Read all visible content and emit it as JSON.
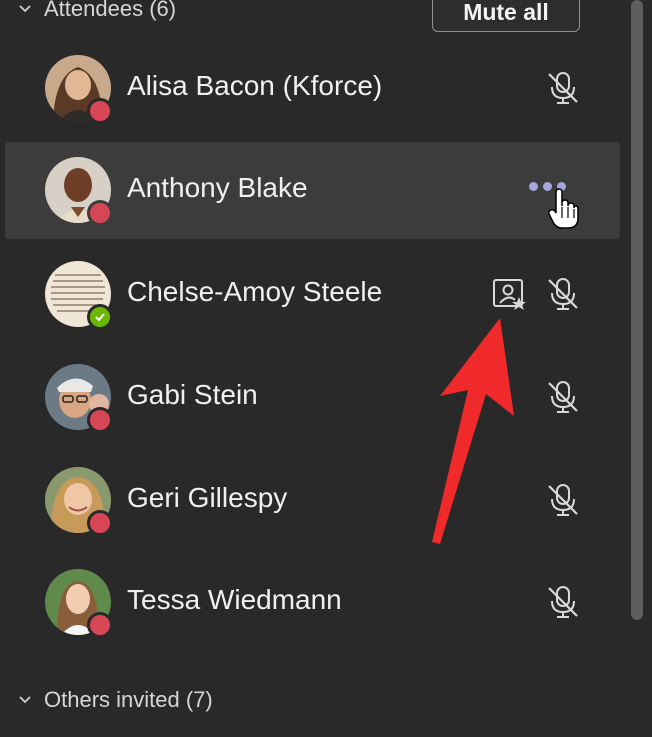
{
  "attendees_section": {
    "label": "Attendees (6)",
    "mute_all_label": "Mute all"
  },
  "others_section": {
    "label": "Others invited (7)"
  },
  "attendees": [
    {
      "name": "Alisa Bacon (Kforce)",
      "status": "busy",
      "mic": "muted"
    },
    {
      "name": "Anthony Blake",
      "status": "busy",
      "hovered": true,
      "action": "more-options"
    },
    {
      "name": "Chelse-Amoy Steele",
      "status": "available",
      "mic": "muted",
      "spotlight": true
    },
    {
      "name": "Gabi Stein",
      "status": "busy",
      "mic": "muted"
    },
    {
      "name": "Geri Gillespy",
      "status": "busy",
      "mic": "muted"
    },
    {
      "name": "Tessa Wiedmann",
      "status": "busy",
      "mic": "muted"
    }
  ],
  "colors": {
    "background": "#292929",
    "hover_row": "#3c3c3c",
    "busy": "#d74654",
    "available": "#6bb700",
    "more_dots": "#a8a6dc",
    "annotation_arrow": "#f02a2a"
  },
  "icons": [
    "chevron-down-icon",
    "mic-off-icon",
    "spotlight-icon",
    "more-options-icon",
    "hand-cursor-icon",
    "annotation-arrow"
  ]
}
